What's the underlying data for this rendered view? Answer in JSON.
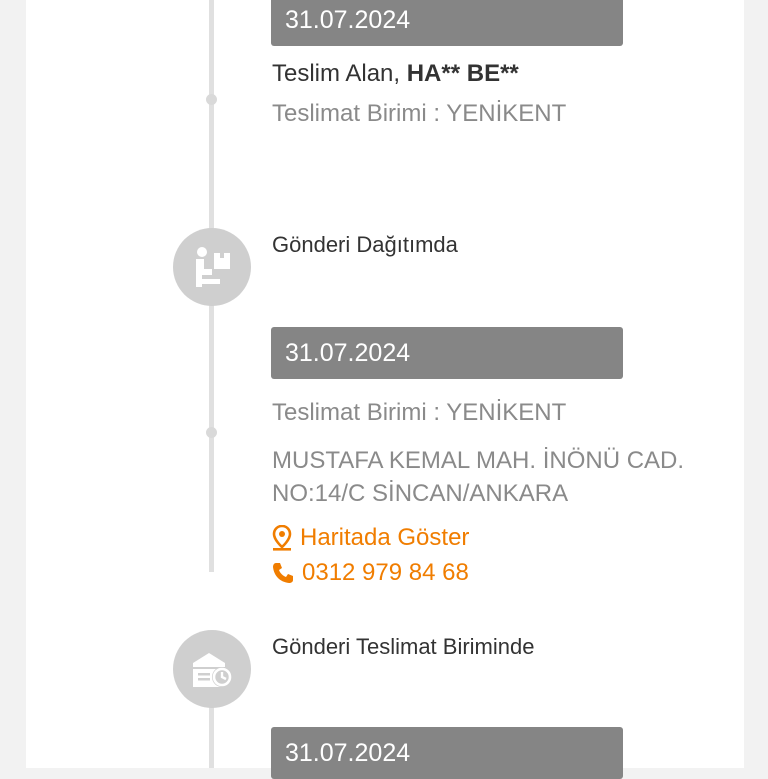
{
  "events": [
    {
      "date": "31.07.2024",
      "receiver_label": "Teslim Alan, ",
      "receiver_name": "HA** BE**",
      "unit_label": "Teslimat Birimi : YENİKENT"
    },
    {
      "title": "Gönderi Dağıtımda",
      "icon": "delivery-worker-icon",
      "date": "31.07.2024",
      "unit_label": "Teslimat Birimi : YENİKENT",
      "address_line1": "MUSTAFA KEMAL MAH. İNÖNÜ CAD.",
      "address_line2": "NO:14/C SİNCAN/ANKARA",
      "map_link": "Haritada Göster",
      "phone": "0312 979 84 68"
    },
    {
      "title": "Gönderi Teslimat Biriminde",
      "icon": "branch-clock-icon",
      "date": "31.07.2024"
    }
  ],
  "colors": {
    "accent": "#f07d00",
    "date_bar": "#858585",
    "icon_circle": "#cfcfcf",
    "timeline": "#e0e0e0"
  }
}
